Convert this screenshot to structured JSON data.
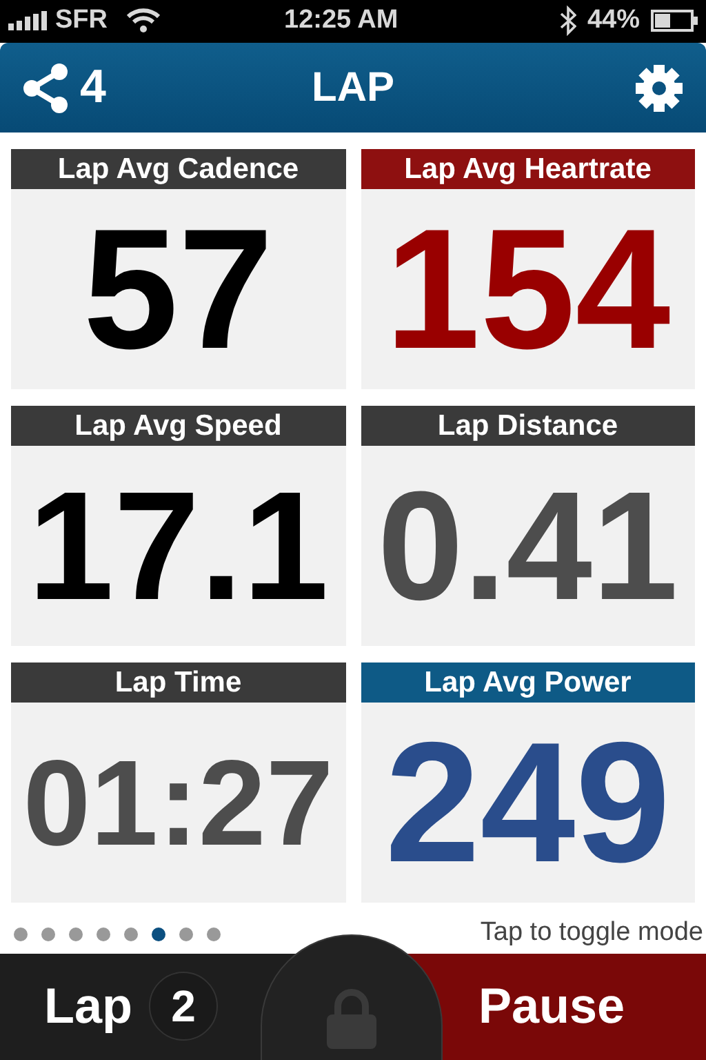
{
  "status_bar": {
    "carrier": "SFR",
    "time": "12:25 AM",
    "battery": "44%"
  },
  "nav_bar": {
    "share_count": "4",
    "title": "LAP"
  },
  "tiles": [
    {
      "label": "Lap Avg Cadence",
      "value": "57",
      "kind": "neutral",
      "color": "#000000"
    },
    {
      "label": "Lap Avg Heartrate",
      "value": "154",
      "kind": "heart",
      "color": "#990000"
    },
    {
      "label": "Lap Avg Speed",
      "value": "17.1",
      "kind": "neutral",
      "color": "#000000"
    },
    {
      "label": "Lap Distance",
      "value": "0.41",
      "kind": "neutral",
      "color": "#4d4d4d"
    },
    {
      "label": "Lap Time",
      "value": "01:27",
      "kind": "neutral",
      "color": "#4d4d4d"
    },
    {
      "label": "Lap Avg Power",
      "value": "249",
      "kind": "power",
      "color": "#2a4d8c"
    }
  ],
  "page_dots": [
    {
      "selected": false
    },
    {
      "selected": false
    },
    {
      "selected": false
    },
    {
      "selected": false
    },
    {
      "selected": false
    },
    {
      "selected": true
    },
    {
      "selected": false
    },
    {
      "selected": false
    }
  ],
  "hint": "Tap to toggle mode",
  "bottom_bar": {
    "lap_label": "Lap",
    "lap_count": "2",
    "pause_label": "Pause"
  }
}
